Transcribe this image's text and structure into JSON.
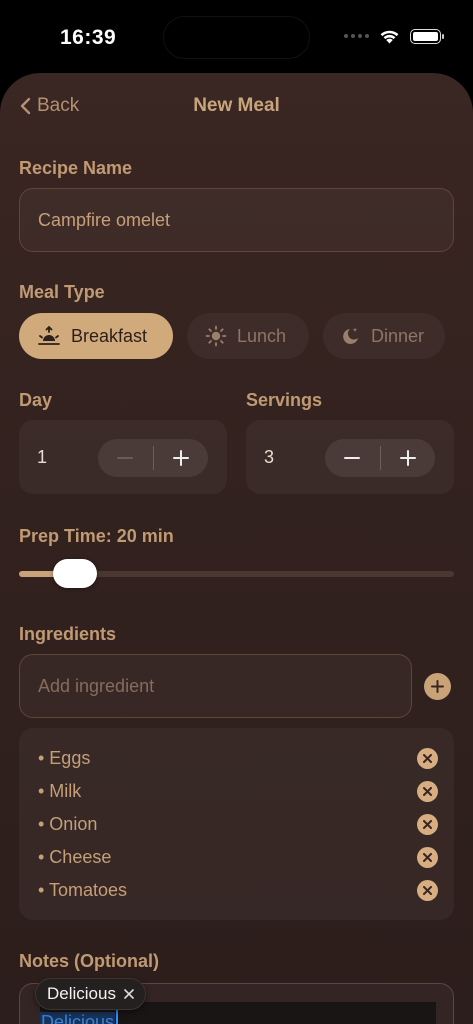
{
  "status_bar": {
    "time": "16:39"
  },
  "nav": {
    "back_label": "Back",
    "title": "New Meal"
  },
  "recipe": {
    "label": "Recipe Name",
    "value": "Campfire omelet"
  },
  "meal_type": {
    "label": "Meal Type",
    "options": [
      {
        "label": "Breakfast",
        "icon": "sunrise-icon",
        "selected": true
      },
      {
        "label": "Lunch",
        "icon": "sun-icon",
        "selected": false
      },
      {
        "label": "Dinner",
        "icon": "moon-stars-icon",
        "selected": false
      }
    ]
  },
  "day": {
    "label": "Day",
    "value": "1"
  },
  "servings": {
    "label": "Servings",
    "value": "3"
  },
  "prep_time": {
    "label": "Prep Time: 20 min",
    "fraction": 0.128
  },
  "ingredients": {
    "label": "Ingredients",
    "placeholder": "Add ingredient",
    "items": [
      "• Eggs",
      "• Milk",
      "• Onion",
      "• Cheese",
      "• Tomatoes"
    ]
  },
  "notes": {
    "label": "Notes (Optional)",
    "value": "Delicious",
    "suggestion": "Delicious"
  },
  "colors": {
    "accent": "#d1aa7c",
    "background": "#33221f",
    "text": "#c09a72"
  }
}
